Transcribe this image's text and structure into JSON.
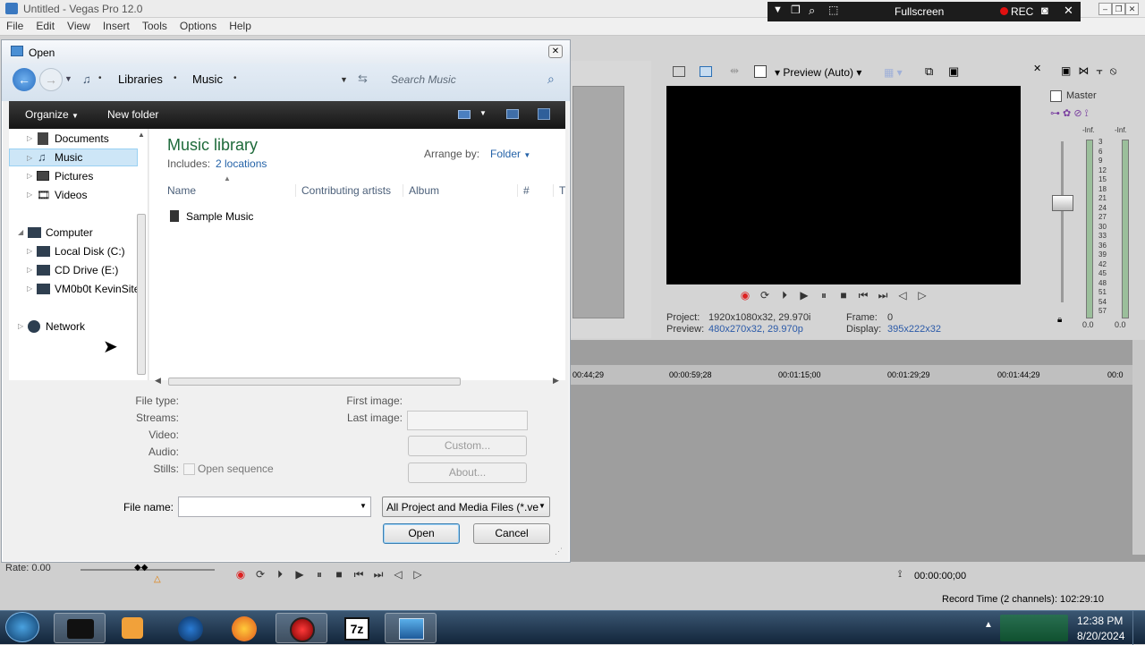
{
  "app": {
    "title": "Untitled - Vegas Pro 12.0",
    "menu": [
      "File",
      "Edit",
      "View",
      "Insert",
      "Tools",
      "Options",
      "Help"
    ],
    "rec_bar": {
      "fullscreen": "Fullscreen",
      "rec": "REC"
    },
    "preview_label": "Preview (Auto)",
    "project_info": {
      "project_label": "Project:",
      "project_value": "1920x1080x32, 29.970i",
      "preview_label": "Preview:",
      "preview_value": "480x270x32, 29.970p",
      "frame_label": "Frame:",
      "frame_value": "0",
      "display_label": "Display:",
      "display_value": "395x222x32"
    },
    "mixer": {
      "title": "Master",
      "inf_left": "-Inf.",
      "inf_right": "-Inf.",
      "scale": [
        "3",
        "6",
        "9",
        "12",
        "15",
        "18",
        "21",
        "24",
        "27",
        "30",
        "33",
        "36",
        "39",
        "42",
        "45",
        "48",
        "51",
        "54",
        "57"
      ],
      "bottom_left": "0.0",
      "bottom_right": "0.0"
    },
    "timeline_ticks": [
      "00:44;29",
      "00:00:59;28",
      "00:01:15;00",
      "00:01:29;29",
      "00:01:44;29",
      "00:0"
    ],
    "rate": "Rate: 0.00",
    "timecode": "00:00:00;00",
    "record_time": "Record Time (2 channels): 102:29:10"
  },
  "dialog": {
    "title": "Open",
    "breadcrumb": [
      "Libraries",
      "Music"
    ],
    "search_placeholder": "Search Music",
    "toolbar": {
      "organize": "Organize",
      "new_folder": "New folder"
    },
    "nav": {
      "libraries": [
        "Documents",
        "Music",
        "Pictures",
        "Videos"
      ],
      "computer": "Computer",
      "drives": [
        "Local Disk (C:)",
        "CD Drive (E:)",
        "VM0b0t KevinSite"
      ],
      "network": "Network"
    },
    "library_title": "Music library",
    "includes_label": "Includes:",
    "includes_link": "2 locations",
    "arrange_label": "Arrange by:",
    "arrange_value": "Folder",
    "columns": [
      "Name",
      "Contributing artists",
      "Album",
      "#",
      "T"
    ],
    "files": [
      "Sample Music"
    ],
    "info": {
      "file_type": "File type:",
      "streams": "Streams:",
      "video": "Video:",
      "audio": "Audio:",
      "stills": "Stills:",
      "open_sequence": "Open sequence",
      "first_image": "First image:",
      "last_image": "Last image:",
      "custom": "Custom...",
      "about": "About..."
    },
    "file_name_label": "File name:",
    "file_name_value": "",
    "file_type_filter": "All Project and Media Files (*.ve",
    "open_button": "Open",
    "cancel_button": "Cancel"
  },
  "taskbar": {
    "time": "12:38 PM",
    "date": "8/20/2024"
  }
}
